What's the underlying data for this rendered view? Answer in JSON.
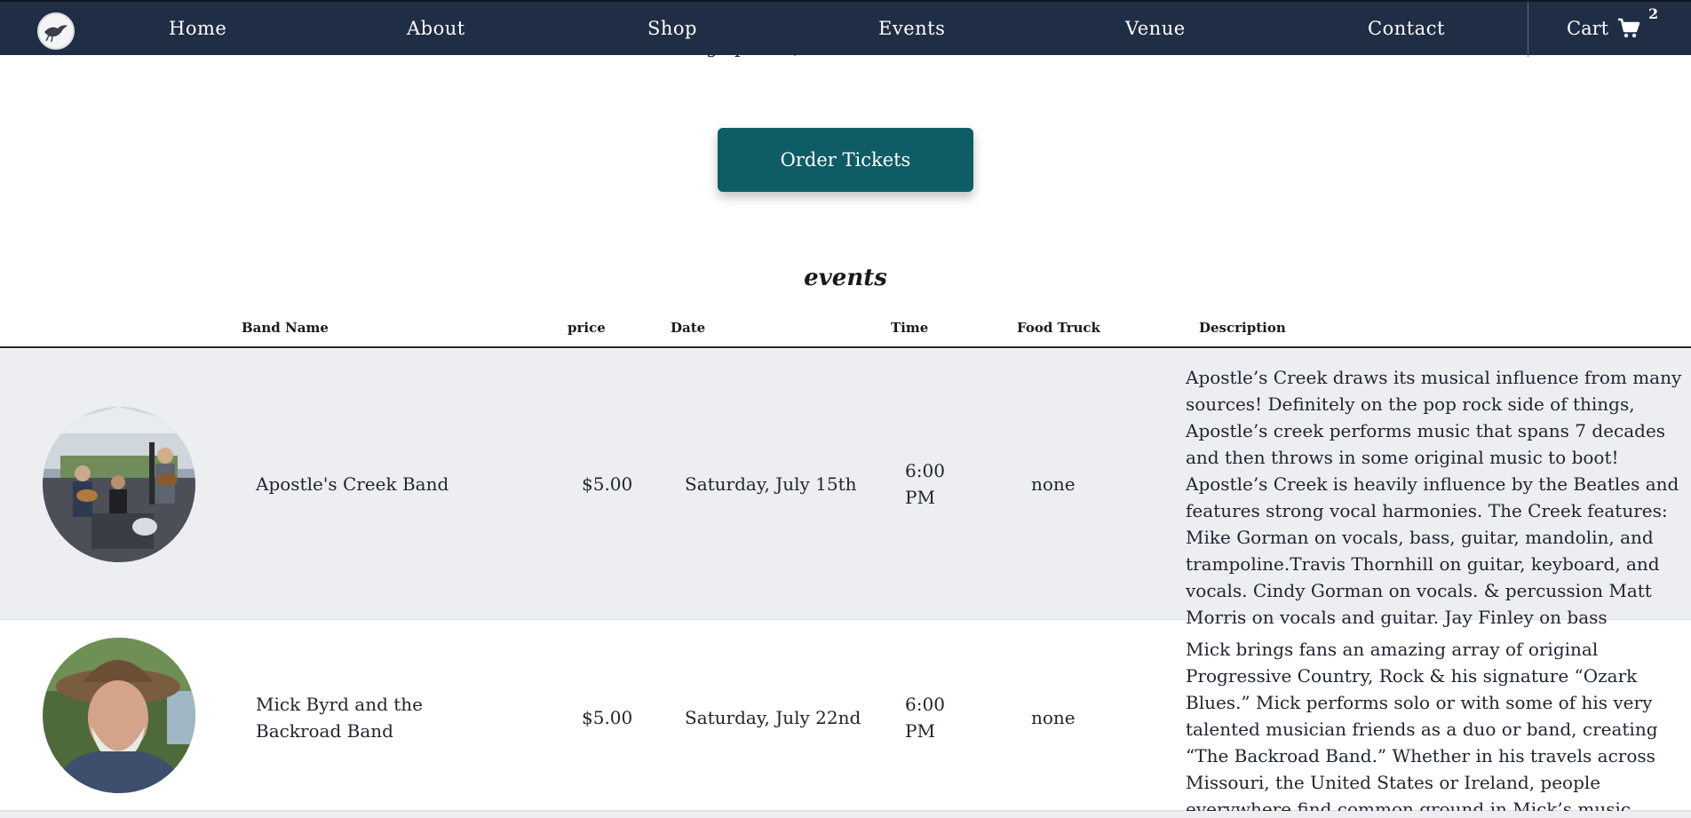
{
  "nav": {
    "logo_icon": "bird-logo-icon",
    "items": [
      {
        "label": "Home"
      },
      {
        "label": "About"
      },
      {
        "label": "Shop"
      },
      {
        "label": "Events"
      },
      {
        "label": "Venue"
      },
      {
        "label": "Contact"
      }
    ],
    "cart_label": "Cart",
    "cart_icon": "shopping-cart-icon",
    "cart_count": "2"
  },
  "hero": {
    "subtitle": "See what's coming up soon, tickets available online or at the door",
    "order_button": "Order Tickets"
  },
  "events": {
    "title": "events",
    "columns": [
      "Band Name",
      "price",
      "Date",
      "Time",
      "Food Truck",
      "Description"
    ],
    "rows": [
      {
        "image": "band-photo",
        "band": "Apostle's Creek Band",
        "price": "$5.00",
        "date": "Saturday, July 15th",
        "time": "6:00 PM",
        "food_truck": "none",
        "description": "Apostle’s Creek draws its musical influence from many sources! Definitely on the pop rock side of things, Apostle’s creek performs music that spans 7 decades and then throws in some original music to boot! Apostle’s Creek is heavily influence by the Beatles and features strong vocal harmonies. The Creek features: Mike Gorman on vocals, bass, guitar, mandolin, and trampoline.Travis Thornhill on guitar, keyboard, and vocals. Cindy Gorman on vocals. & percussion Matt Morris on vocals and guitar. Jay Finley on bass"
      },
      {
        "image": "musician-portrait",
        "band": "Mick Byrd and the Backroad Band",
        "price": "$5.00",
        "date": "Saturday, July 22nd",
        "time": "6:00 PM",
        "food_truck": "none",
        "description": "Mick brings fans an amazing array of original Progressive Country, Rock & his signature “Ozark Blues.” Mick performs solo or with some of his very talented musician friends as a duo or band, creating “The Backroad Band.” Whether in his travels across Missouri, the United States or Ireland, people everywhere find common ground in Mick’s music."
      }
    ]
  }
}
